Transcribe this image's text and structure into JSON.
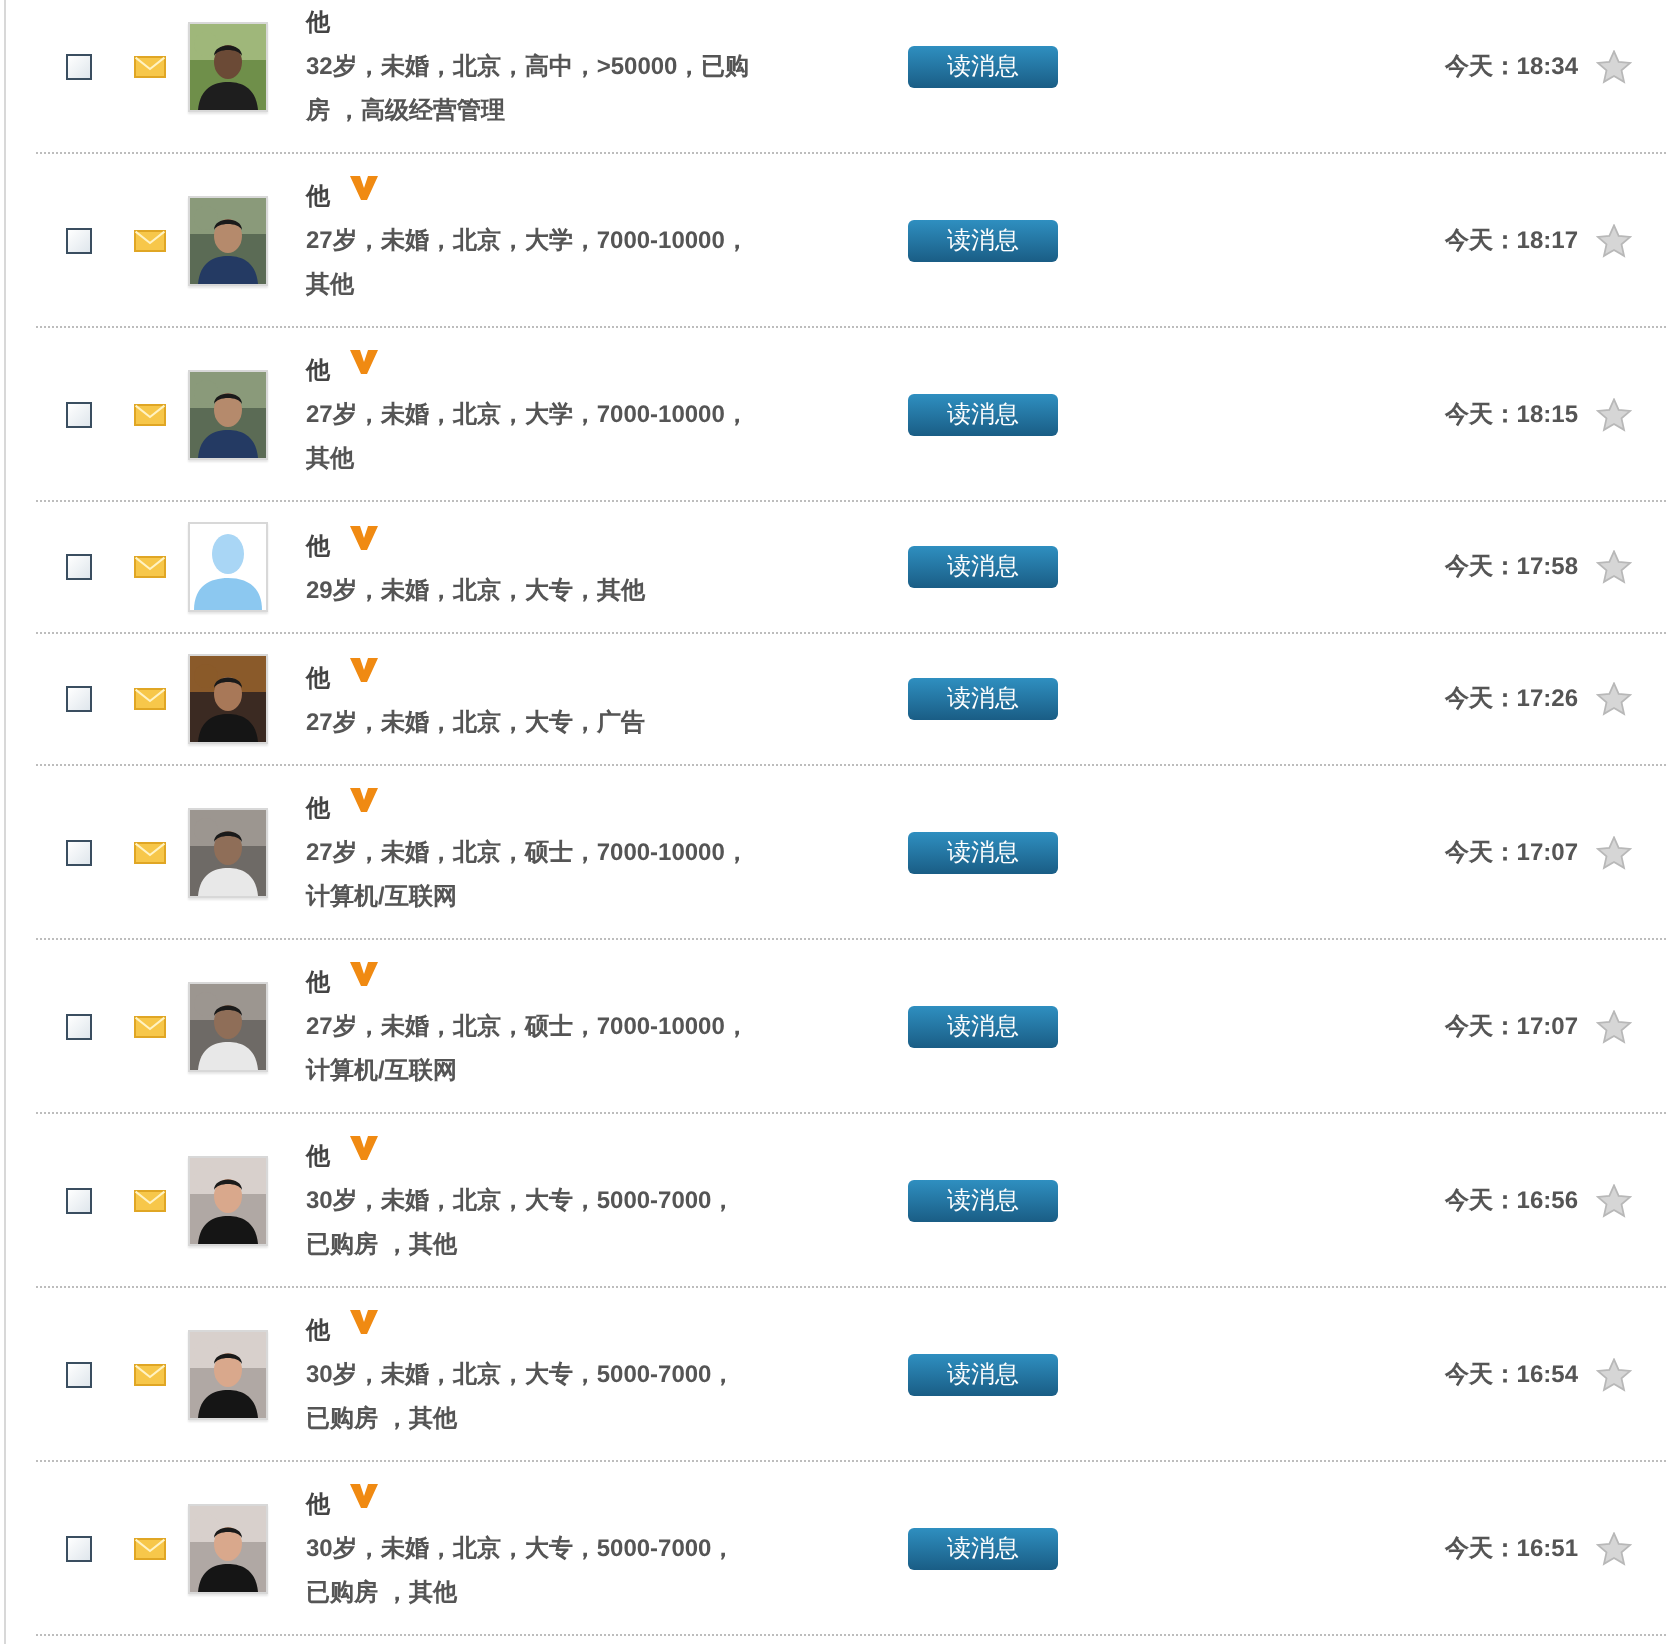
{
  "messages": [
    {
      "checked": false,
      "name": "他",
      "vip": false,
      "info": "32岁，未婚，北京，高中，>50000，已购房 ，高级经营管理",
      "button": "读消息",
      "time": "今天：18:34",
      "starred": false
    },
    {
      "checked": false,
      "name": "他",
      "vip": true,
      "info": "27岁，未婚，北京，大学，7000-10000，其他",
      "button": "读消息",
      "time": "今天：18:17",
      "starred": false
    },
    {
      "checked": false,
      "name": "他",
      "vip": true,
      "info": "27岁，未婚，北京，大学，7000-10000，其他",
      "button": "读消息",
      "time": "今天：18:15",
      "starred": false
    },
    {
      "checked": false,
      "avatar": {
        "kind": "default"
      },
      "name": "他",
      "vip": true,
      "info": "29岁，未婚，北京，大专，其他",
      "button": "读消息",
      "time": "今天：17:58",
      "starred": false
    },
    {
      "checked": false,
      "name": "他",
      "vip": true,
      "info": "27岁，未婚，北京，大专，广告",
      "button": "读消息",
      "time": "今天：17:26",
      "starred": false
    },
    {
      "checked": false,
      "name": "他",
      "vip": true,
      "info": "27岁，未婚，北京，硕士，7000-10000，计算机/互联网",
      "button": "读消息",
      "time": "今天：17:07",
      "starred": false
    },
    {
      "checked": false,
      "name": "他",
      "vip": true,
      "info": "27岁，未婚，北京，硕士，7000-10000，计算机/互联网",
      "button": "读消息",
      "time": "今天：17:07",
      "starred": false
    },
    {
      "checked": false,
      "name": "他",
      "vip": true,
      "info": "30岁，未婚，北京，大专，5000-7000，已购房 ，其他",
      "button": "读消息",
      "time": "今天：16:56",
      "starred": false
    },
    {
      "checked": false,
      "name": "他",
      "vip": true,
      "info": "30岁，未婚，北京，大专，5000-7000，已购房 ，其他",
      "button": "读消息",
      "time": "今天：16:54",
      "starred": false
    },
    {
      "checked": false,
      "name": "他",
      "vip": true,
      "info": "30岁，未婚，北京，大专，5000-7000，已购房 ，其他",
      "button": "读消息",
      "time": "今天：16:51",
      "starred": false
    }
  ]
}
